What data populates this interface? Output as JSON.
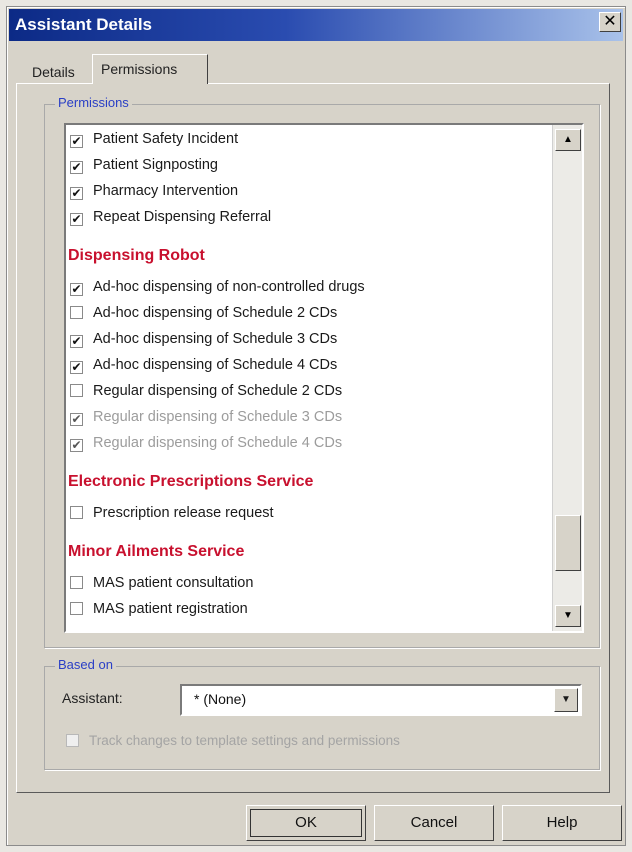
{
  "window": {
    "title": "Assistant Details"
  },
  "tabs": [
    {
      "label": "Details"
    },
    {
      "label": "Permissions"
    }
  ],
  "permissions": {
    "legend": "Permissions",
    "rows": [
      {
        "label": "Patient Safety Incident",
        "checked": true,
        "disabled": false
      },
      {
        "label": "Patient Signposting",
        "checked": true,
        "disabled": false
      },
      {
        "label": "Pharmacy Intervention",
        "checked": true,
        "disabled": false
      },
      {
        "label": "Repeat Dispensing Referral",
        "checked": true,
        "disabled": false
      }
    ],
    "sections": [
      {
        "title": "Dispensing Robot",
        "items": [
          {
            "label": "Ad-hoc dispensing of non-controlled drugs",
            "checked": true,
            "disabled": false
          },
          {
            "label": "Ad-hoc dispensing of Schedule 2 CDs",
            "checked": false,
            "disabled": false
          },
          {
            "label": "Ad-hoc dispensing of Schedule 3 CDs",
            "checked": true,
            "disabled": false
          },
          {
            "label": "Ad-hoc dispensing of Schedule 4 CDs",
            "checked": true,
            "disabled": false
          },
          {
            "label": "Regular dispensing of Schedule 2 CDs",
            "checked": false,
            "disabled": false
          },
          {
            "label": "Regular dispensing of Schedule 3 CDs",
            "checked": true,
            "disabled": true
          },
          {
            "label": "Regular dispensing of Schedule 4 CDs",
            "checked": true,
            "disabled": true
          }
        ]
      },
      {
        "title": "Electronic Prescriptions Service",
        "items": [
          {
            "label": "Prescription release request",
            "checked": false,
            "disabled": false
          }
        ]
      },
      {
        "title": "Minor Ailments Service",
        "items": [
          {
            "label": "MAS patient consultation",
            "checked": false,
            "disabled": false
          },
          {
            "label": "MAS patient registration",
            "checked": false,
            "disabled": false
          }
        ]
      }
    ]
  },
  "based_on": {
    "legend": "Based on",
    "assistant_label": "Assistant:",
    "assistant_value": "*  (None)",
    "track_label": "Track changes to template settings and permissions",
    "track_checked": false
  },
  "buttons": {
    "ok": "OK",
    "cancel": "Cancel",
    "help": "Help"
  }
}
